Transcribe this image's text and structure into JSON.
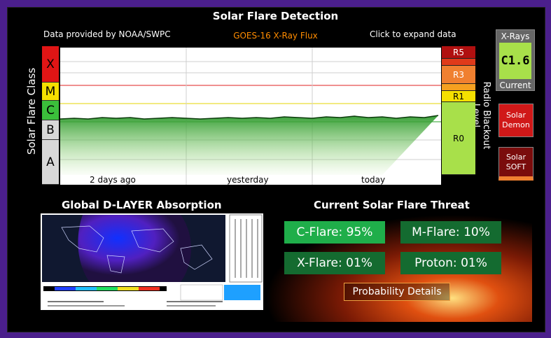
{
  "header": {
    "title": "Solar Flare Detection",
    "provider": "Data provided by NOAA/SWPC",
    "subtitle": "GOES-16 X-Ray Flux",
    "expand": "Click to expand data"
  },
  "left_axis_label": "Solar Flare Class",
  "right_axis_label": "Radio Blackout Level",
  "flare_classes": [
    {
      "label": "X",
      "color": "#e01515"
    },
    {
      "label": "M",
      "color": "#f5e000"
    },
    {
      "label": "C",
      "color": "#3bbf3b"
    },
    {
      "label": "B",
      "color": "#d8d8d8"
    },
    {
      "label": "A",
      "color": "#d8d8d8"
    }
  ],
  "radio_levels": [
    {
      "label": "R5",
      "color": "#b01010"
    },
    {
      "label": "R3",
      "color": "#f08030"
    },
    {
      "label": "R1",
      "color": "#f5e000"
    },
    {
      "label": "R0",
      "color": "#a8e04a"
    }
  ],
  "time_ticks": [
    "2 days ago",
    "yesterday",
    "today"
  ],
  "current_xray": {
    "title": "X-Rays",
    "value": "C1.6",
    "caption": "Current"
  },
  "solar_demon": {
    "line1": "Solar",
    "line2": "Demon"
  },
  "solar_soft": {
    "line1": "Solar",
    "line2": "SOFT"
  },
  "dlayer": {
    "title": "Global D-LAYER Absorption"
  },
  "threat": {
    "title": "Current Solar Flare Threat",
    "c_flare": "C-Flare: 95%",
    "m_flare": "M-Flare: 10%",
    "x_flare": "X-Flare: 01%",
    "proton": "Proton: 01%",
    "details": "Probability Details"
  }
}
